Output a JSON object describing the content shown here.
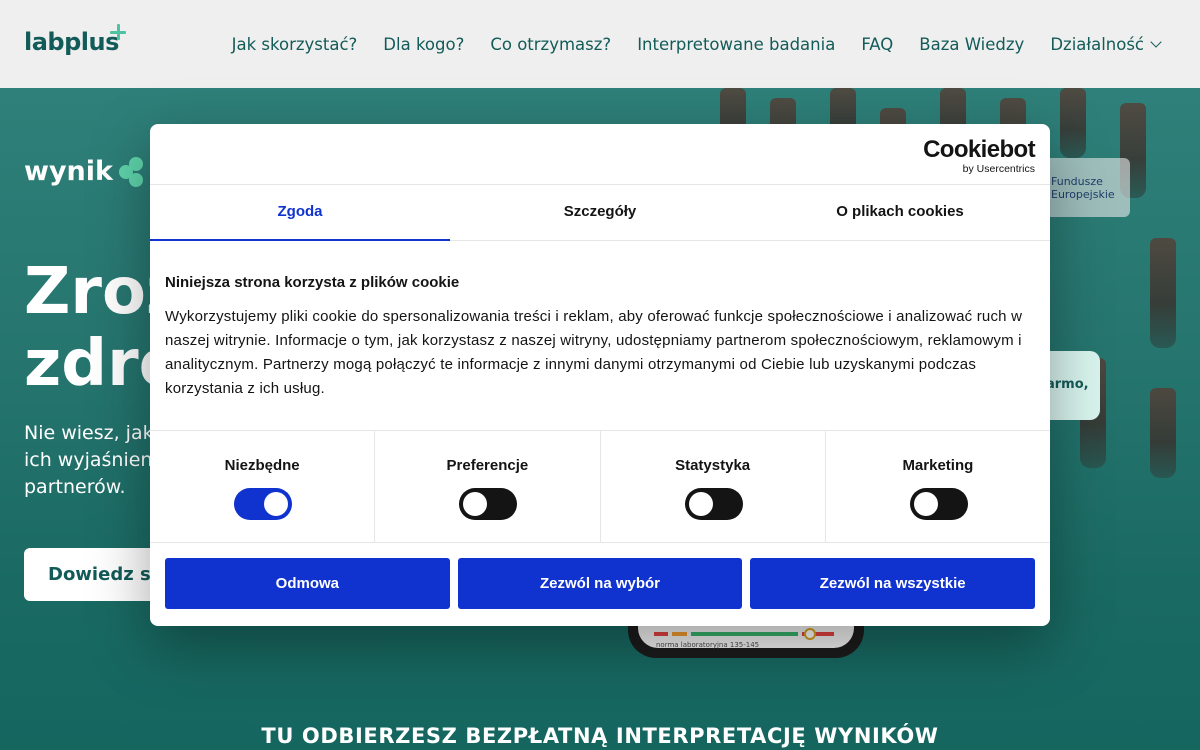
{
  "header": {
    "logo_text": "labplus",
    "nav": [
      "Jak skorzystać?",
      "Dla kogo?",
      "Co otrzymasz?",
      "Interpretowane badania",
      "FAQ",
      "Baza Wiedzy",
      "Działalność"
    ]
  },
  "hero": {
    "brand": "wynik",
    "title_line1": "Zroz",
    "title_line2": "zdro",
    "subtitle_line1": "Nie wiesz, jak i",
    "subtitle_line2": "ich wyjaśnienie",
    "subtitle_line3": "partnerów.",
    "cta": "Dowiedz się",
    "eu_badge_line1": "Fundusze",
    "eu_badge_line2": "Europejskie",
    "side_card": "armo,",
    "phone_label": "norma laboratoryjna 135-145",
    "bottom_title": "TU ODBIERZESZ BEZPŁATNĄ INTERPRETACJĘ WYNIKÓW"
  },
  "cookie": {
    "brand": "Cookiebot",
    "brand_sub": "by Usercentrics",
    "tabs": [
      "Zgoda",
      "Szczegóły",
      "O plikach cookies"
    ],
    "title": "Niniejsza strona korzysta z plików cookie",
    "text": "Wykorzystujemy pliki cookie do spersonalizowania treści i reklam, aby oferować funkcje społecznościowe i analizować ruch w naszej witrynie. Informacje o tym, jak korzystasz z naszej witryny, udostępniamy partnerom społecznościowym, reklamowym i analitycznym. Partnerzy mogą połączyć te informacje z innymi danymi otrzymanymi od Ciebie lub uzyskanymi podczas korzystania z ich usług.",
    "toggles": [
      {
        "label": "Niezbędne",
        "on": true
      },
      {
        "label": "Preferencje",
        "on": false
      },
      {
        "label": "Statystyka",
        "on": false
      },
      {
        "label": "Marketing",
        "on": false
      }
    ],
    "buttons": [
      "Odmowa",
      "Zezwól na wybór",
      "Zezwól na wszystkie"
    ],
    "colors": {
      "accent": "#1032cf",
      "text": "#141414"
    }
  }
}
